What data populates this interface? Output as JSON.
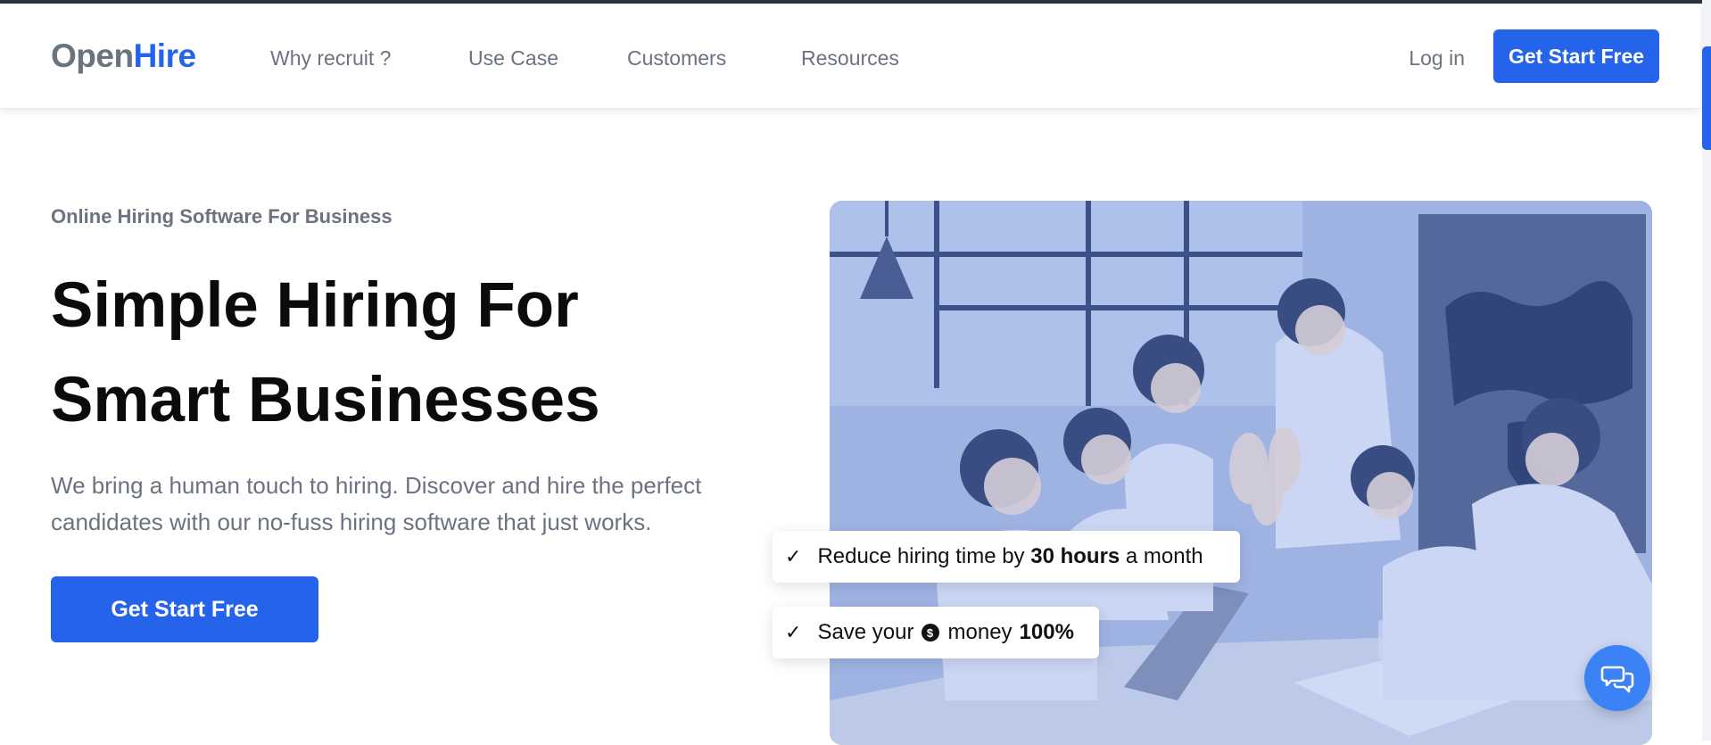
{
  "brand": {
    "name_part1": "Open",
    "name_part2": "Hire",
    "accent_color": "#2563eb"
  },
  "nav": {
    "links": [
      "Why recruit ?",
      "Use Case",
      "Customers",
      "Resources"
    ],
    "login": "Log in",
    "cta": "Get Start Free"
  },
  "hero": {
    "eyebrow": "Online Hiring Software For Business",
    "headline_line1": "Simple Hiring For",
    "headline_line2": "Smart Businesses",
    "subtext": "We bring a human touch to hiring. Discover and hire the perfect candidates with our no-fuss hiring software that just works.",
    "cta": "Get Start Free",
    "image": {
      "description_icon": "team-high-five-photo"
    }
  },
  "badges": {
    "first": {
      "pre": "Reduce hiring time by ",
      "bold": "30 hours",
      "post": " a month",
      "icon": "check-icon"
    },
    "second": {
      "pre": "Save your",
      "bold": "100%",
      "mid": "money",
      "icon": "dollar-icon"
    }
  },
  "chat_widget": {
    "icon": "chat-bubbles-icon",
    "color": "#3b82f6"
  }
}
